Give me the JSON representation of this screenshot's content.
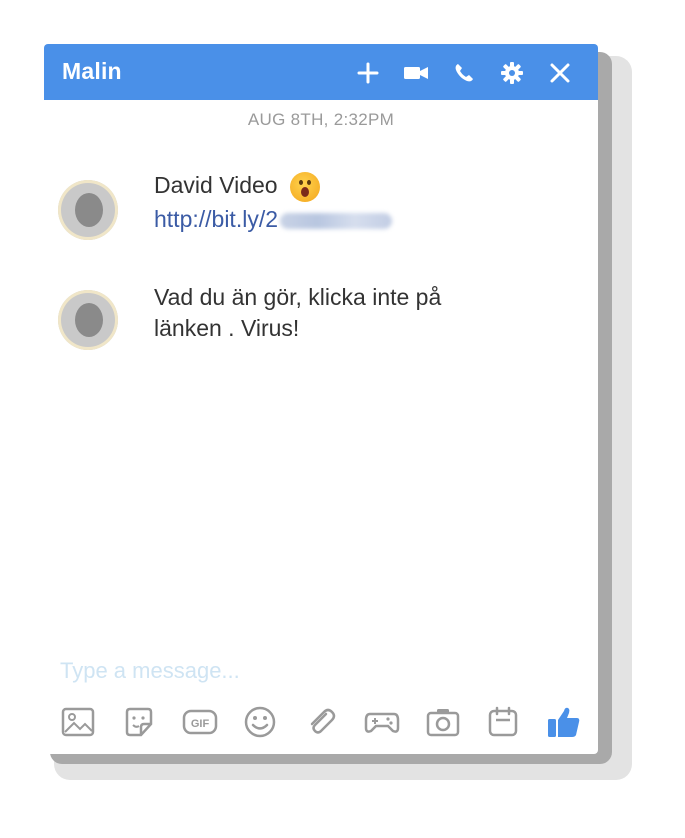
{
  "chat": {
    "contact_name": "Malin",
    "timestamp": "AUG 8TH, 2:32PM",
    "messages": [
      {
        "line1": "David Video",
        "emoji": "astonished-face-emoji",
        "link_visible": "http://bit.ly/2"
      },
      {
        "line1": "Vad du än gör, klicka inte på",
        "line2": "länken . Virus!"
      }
    ]
  },
  "composer": {
    "placeholder": "Type a message..."
  },
  "icons": {
    "titlebar": [
      "plus-icon",
      "video-camera-icon",
      "phone-icon",
      "gear-icon",
      "close-icon"
    ],
    "toolbar": [
      "image-icon",
      "sticker-icon",
      "gif-icon",
      "emoji-icon",
      "paperclip-icon",
      "game-controller-icon",
      "camera-icon",
      "calendar-icon",
      "thumbs-up-icon"
    ],
    "gif_label": "GIF"
  },
  "colors": {
    "header": "#4a90e8",
    "link": "#3b5ba5",
    "icon_gray": "#9a9a9a",
    "like_blue": "#4a90e8"
  }
}
